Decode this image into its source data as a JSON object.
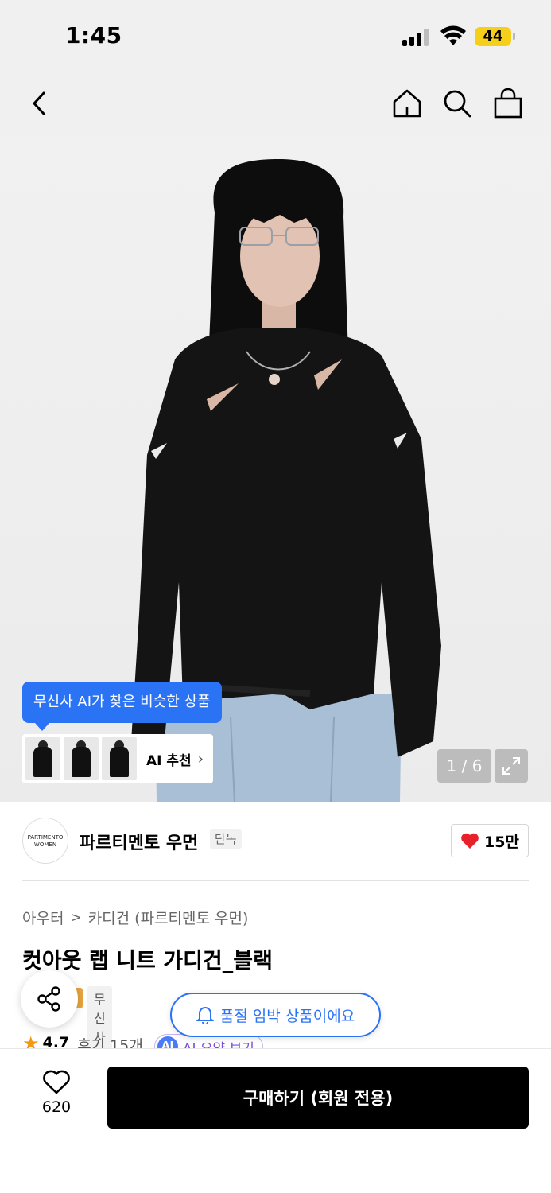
{
  "status_bar": {
    "time": "1:45",
    "battery": "44"
  },
  "nav": {
    "back_icon": "chevron-left-icon",
    "home_icon": "home-icon",
    "search_icon": "search-icon",
    "cart_icon": "shopping-bag-icon"
  },
  "hero": {
    "ai_tooltip": "무신사 AI가 찾은 비슷한 상품",
    "ai_recommend_label": "AI 추천",
    "ai_recommend_arrow": "›",
    "page_indicator": "1 / 6"
  },
  "brand": {
    "logo_line1": "PARTIMENTO",
    "logo_line2": "WOMEN",
    "name": "파르티멘토 우먼",
    "badge": "단독",
    "like_count": "15만",
    "like_color": "#e8202a"
  },
  "breadcrumb": {
    "items": [
      "아우터",
      "카디건 (파르티멘토 우먼)"
    ],
    "separator": ">"
  },
  "product": {
    "title": "컷아웃 랩 니트 가디건_블랙",
    "tag_exclusive": "무신사단독",
    "soldout_notice": "품절 임박 상품이에요",
    "rating": "4.7",
    "review_count": "후기 15개",
    "ai_badge": "AI",
    "ai_summary": "AI 요약 보기"
  },
  "bottom_bar": {
    "wish_count": "620",
    "buy_label": "구매하기 (회원 전용)"
  },
  "colors": {
    "accent_blue": "#2b73f5",
    "star": "#f39a14",
    "buy_bg": "#000000"
  }
}
